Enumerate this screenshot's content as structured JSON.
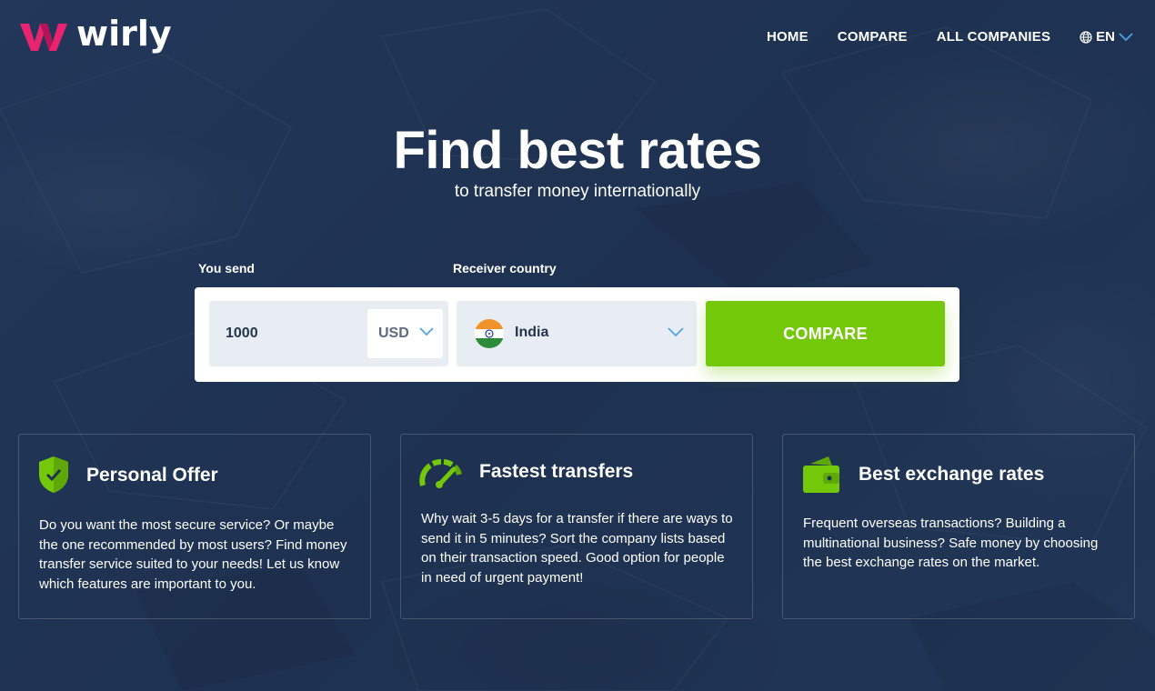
{
  "brand": {
    "name": "wirly",
    "accent": "#e8246e"
  },
  "nav": {
    "items": [
      {
        "label": "HOME"
      },
      {
        "label": "COMPARE"
      },
      {
        "label": "ALL COMPANIES"
      }
    ],
    "language": "EN"
  },
  "hero": {
    "title": "Find best rates",
    "subtitle": "to transfer money internationally"
  },
  "form": {
    "send_label": "You send",
    "amount_value": "1000",
    "currency": "USD",
    "receiver_label": "Receiver country",
    "country": "India",
    "compare_label": "COMPARE",
    "compare_color": "#74c80a"
  },
  "features": [
    {
      "icon": "shield-check-icon",
      "title": "Personal Offer",
      "text": "Do you want the most secure service? Or maybe the one recommended by most users? Find money transfer service suited to your needs! Let us know which features are important to you."
    },
    {
      "icon": "speedometer-icon",
      "title": "Fastest transfers",
      "text": "Why wait 3-5 days for a transfer if there are ways to send it in 5 minutes? Sort the company lists based on their transaction speed. Good option for people in need of urgent payment!"
    },
    {
      "icon": "wallet-icon",
      "title": "Best exchange rates",
      "text": "Frequent overseas transactions? Building a multinational business? Safe money by choosing the best exchange rates on the market."
    }
  ]
}
